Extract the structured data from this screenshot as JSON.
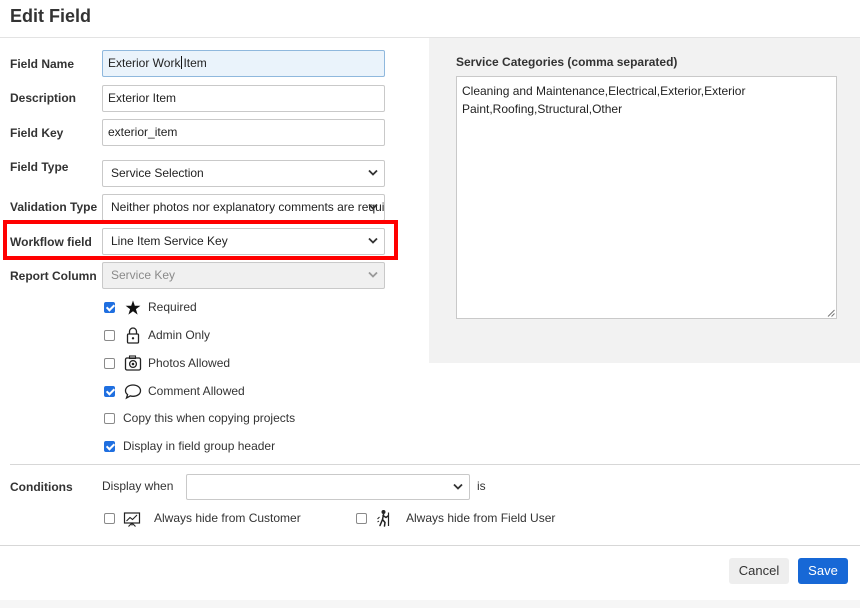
{
  "header": {
    "title": "Edit Field"
  },
  "form": {
    "field_name": {
      "label": "Field Name",
      "value_before_caret": "Exterior Work",
      "value_after_caret": "Item"
    },
    "description": {
      "label": "Description",
      "value": "Exterior Item"
    },
    "field_key": {
      "label": "Field Key",
      "value": "exterior_item"
    },
    "field_type": {
      "label": "Field Type",
      "value": "Service Selection"
    },
    "validation_type": {
      "label": "Validation Type",
      "value": "Neither photos nor explanatory comments are required"
    },
    "workflow_field": {
      "label": "Workflow field",
      "value": "Line Item Service Key"
    },
    "report_column": {
      "label": "Report Column",
      "value": "Service Key"
    }
  },
  "options": [
    {
      "label": "Required",
      "checked": true,
      "icon": "asterisk-icon"
    },
    {
      "label": "Admin Only",
      "checked": false,
      "icon": "lock-icon"
    },
    {
      "label": "Photos Allowed",
      "checked": false,
      "icon": "camera-icon"
    },
    {
      "label": "Comment Allowed",
      "checked": true,
      "icon": "speech-bubble-icon"
    },
    {
      "label": "Copy this when copying projects",
      "checked": false,
      "icon": ""
    },
    {
      "label": "Display in field group header",
      "checked": true,
      "icon": ""
    }
  ],
  "service_categories": {
    "label": "Service Categories (comma separated)",
    "value": "Cleaning and Maintenance,Electrical,Exterior,Exterior Paint,Roofing,Structural,Other"
  },
  "conditions": {
    "label": "Conditions",
    "display_when": "Display when",
    "display_when_value": "",
    "is": "is",
    "hide_customer": {
      "label": "Always hide from Customer",
      "checked": false,
      "icon": "presentation-icon"
    },
    "hide_field_user": {
      "label": "Always hide from Field User",
      "checked": false,
      "icon": "worker-icon"
    }
  },
  "buttons": {
    "cancel": "Cancel",
    "save": "Save"
  },
  "colors": {
    "accent": "#1768d6",
    "highlight": "#ff0000",
    "panel": "#f2f2f2"
  }
}
